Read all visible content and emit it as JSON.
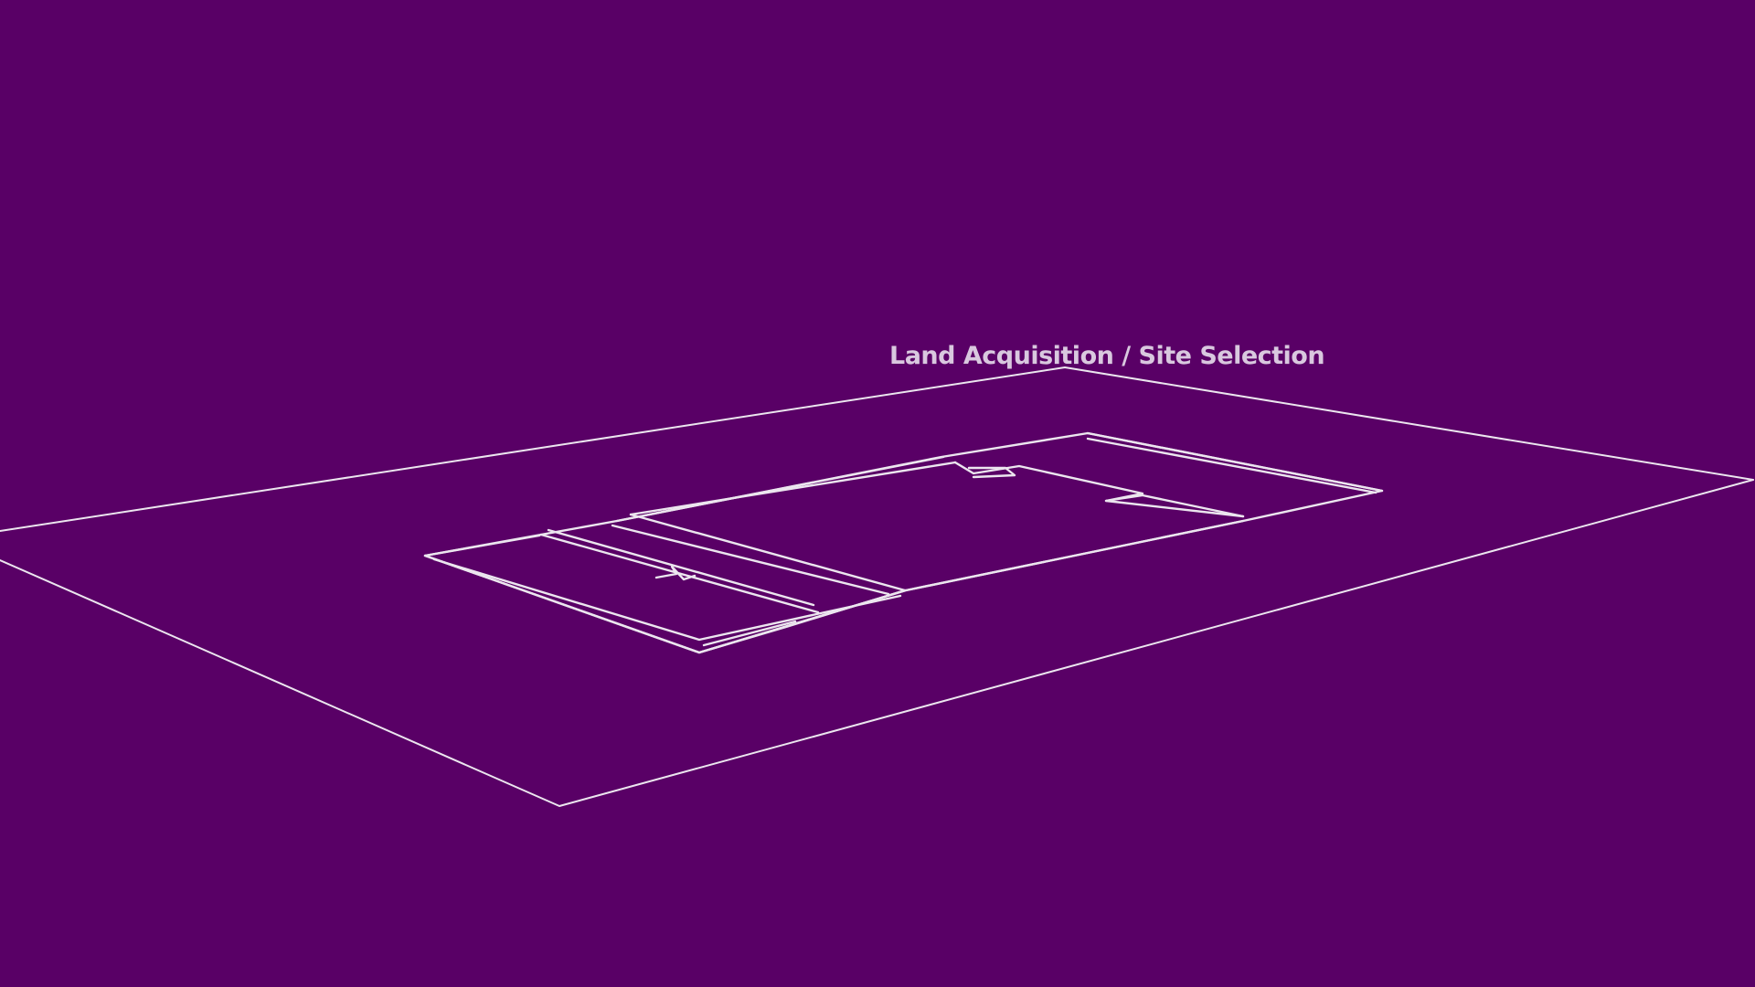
{
  "caption": "Land Acquisition / Site Selection",
  "colors": {
    "background": "#590066",
    "line": "#ece6ef",
    "caption": "#d9c8df"
  }
}
